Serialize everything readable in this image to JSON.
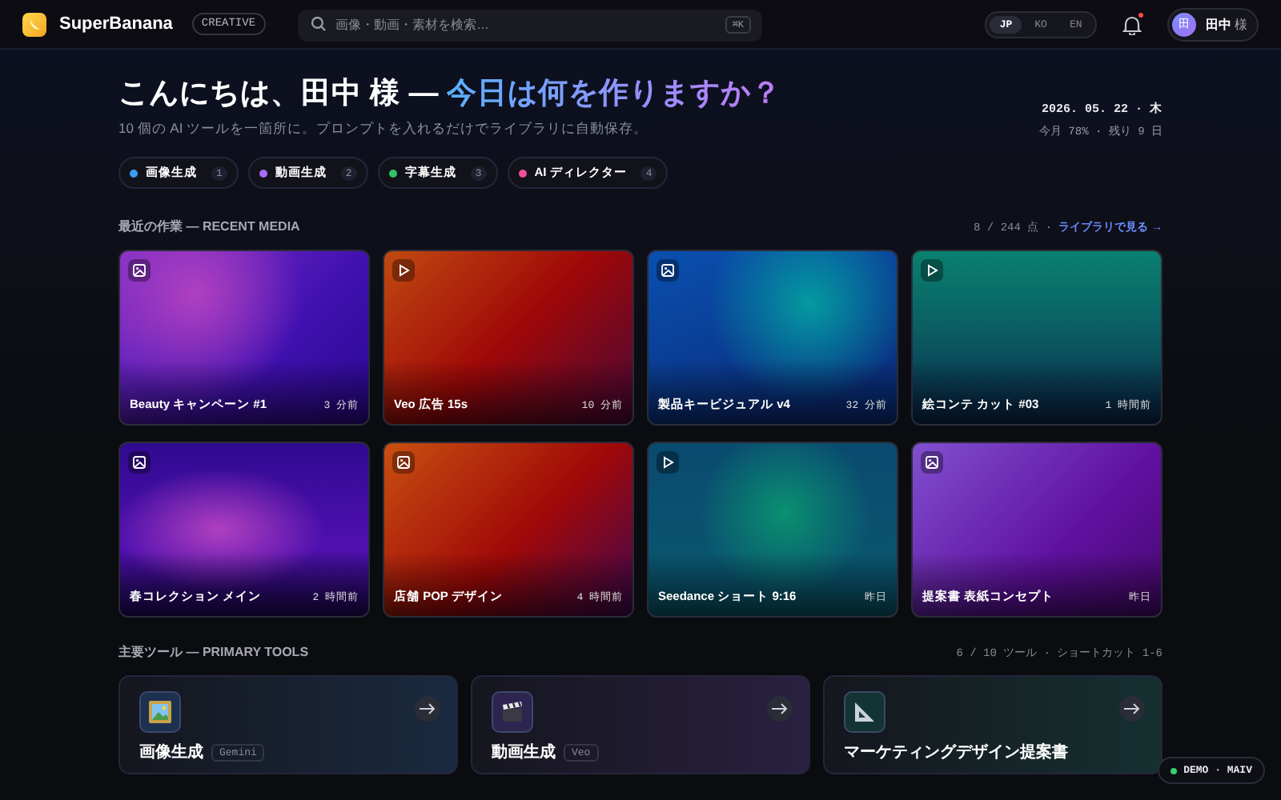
{
  "header": {
    "brand": "SuperBanana",
    "edition": "CREATIVE",
    "search": {
      "placeholder": "画像・動画・素材を検索…",
      "shortcut": "⌘K"
    },
    "languages": [
      {
        "label": "JP",
        "selected": true
      },
      {
        "label": "KO",
        "selected": false
      },
      {
        "label": "EN",
        "selected": false
      }
    ],
    "notifications": {
      "unread": true
    },
    "user": {
      "initial": "田",
      "name": "田中",
      "honorific": "様"
    }
  },
  "hero": {
    "greeting": "こんにちは、田中 様 — ",
    "highlight": "今日は何を作りますか？",
    "subtitle": "10 個の AI ツールを一箇所に。プロンプトを入れるだけでライブラリに自動保存。",
    "date": "2026. 05. 22 · 木",
    "usage": "今月 78% · 残り 9 日",
    "chips": [
      {
        "label": "画像生成",
        "shortcut": "1",
        "color": "#3b9cf5"
      },
      {
        "label": "動画生成",
        "shortcut": "2",
        "color": "#a66cf7"
      },
      {
        "label": "字幕生成",
        "shortcut": "3",
        "color": "#2fc46a"
      },
      {
        "label": "AI ディレクター",
        "shortcut": "4",
        "color": "#f0509a"
      }
    ]
  },
  "recent": {
    "title": "最近の作業 — RECENT MEDIA",
    "count": "8 / 244 点 ·",
    "link": "ライブラリで見る →",
    "items": [
      {
        "kind": "image",
        "title": "Beauty キャンペーン #1",
        "time": "3 分前"
      },
      {
        "kind": "video",
        "title": "Veo 広告 15s",
        "time": "10 分前"
      },
      {
        "kind": "image",
        "title": "製品キービジュアル v4",
        "time": "32 分前"
      },
      {
        "kind": "video",
        "title": "絵コンテ カット #03",
        "time": "1 時間前"
      },
      {
        "kind": "image",
        "title": "春コレクション メイン",
        "time": "2 時間前"
      },
      {
        "kind": "image",
        "title": "店舗 POP デザイン",
        "time": "4 時間前"
      },
      {
        "kind": "video",
        "title": "Seedance ショート 9:16",
        "time": "昨日"
      },
      {
        "kind": "image",
        "title": "提案書 表紙コンセプト",
        "time": "昨日"
      }
    ]
  },
  "tools": {
    "title": "主要ツール — PRIMARY TOOLS",
    "meta": "6 / 10 ツール · ショートカット 1-6",
    "items": [
      {
        "kind": "picture",
        "title": "画像生成",
        "model": "Gemini"
      },
      {
        "kind": "clapper",
        "title": "動画生成",
        "model": "Veo"
      },
      {
        "kind": "ruler",
        "title": "マーケティングデザイン提案書"
      }
    ]
  },
  "demo_badge": "DEMO · MAIV"
}
